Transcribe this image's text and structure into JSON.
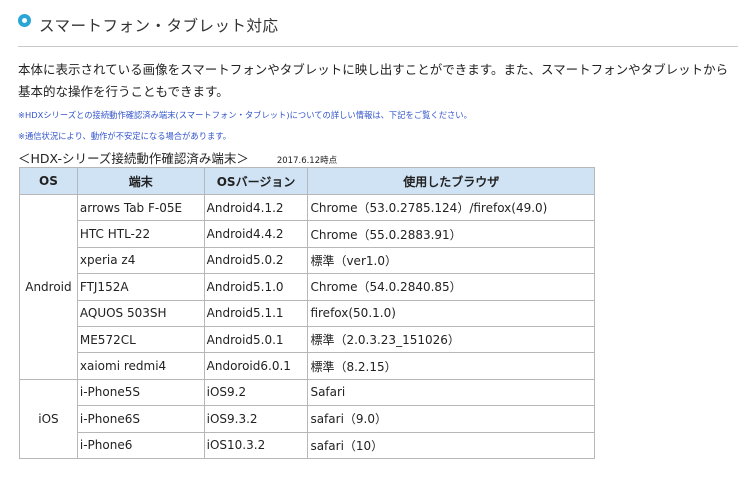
{
  "section": {
    "title": "スマートフォン・タブレット対応",
    "intro": "本体に表示されている画像をスマートフォンやタブレットに映し出すことができます。また、スマートフォンやタブレットから基本的な操作を行うこともできます。",
    "note1": "※HDXシリーズとの接続動作確認済み端末(スマートフォン・タブレット)についての詳しい情報は、下記をご覧ください。",
    "note2": "※通信状況により、動作が不安定になる場合があります。",
    "list_heading": "＜HDX-シリーズ接続動作確認済み端末＞",
    "list_date": "2017.6.12時点"
  },
  "table": {
    "headers": [
      "OS",
      "端末",
      "OSバージョン",
      "使用したブラウザ"
    ],
    "groups": [
      {
        "os": "Android",
        "rows": [
          [
            "arrows Tab F-05E",
            "Android4.1.2",
            "Chrome（53.0.2785.124）/firefox(49.0)"
          ],
          [
            "HTC HTL-22",
            "Android4.4.2",
            "Chrome（55.0.2883.91）"
          ],
          [
            "xperia z4",
            "Android5.0.2",
            "標準（ver1.0）"
          ],
          [
            "FTJ152A",
            "Android5.1.0",
            "Chrome（54.0.2840.85）"
          ],
          [
            "AQUOS 503SH",
            "Android5.1.1",
            "firefox(50.1.0)"
          ],
          [
            "ME572CL",
            "Android5.0.1",
            "標準（2.0.3.23_151026）"
          ],
          [
            "xaiomi redmi4",
            "Andoroid6.0.1",
            "標準（8.2.15）"
          ]
        ]
      },
      {
        "os": "iOS",
        "rows": [
          [
            "i-Phone5S",
            "iOS9.2",
            "Safari"
          ],
          [
            "i-Phone6S",
            "iOS9.3.2",
            "safari（9.0）"
          ],
          [
            "i-Phone6",
            "iOS10.3.2",
            "safari（10）"
          ]
        ]
      }
    ]
  },
  "colors": {
    "accent": "#2aa6d6",
    "header_bg": "#cfe3f5",
    "note_text": "#3355cc"
  },
  "icons": {
    "title_bullet": "ring-bullet-icon"
  }
}
